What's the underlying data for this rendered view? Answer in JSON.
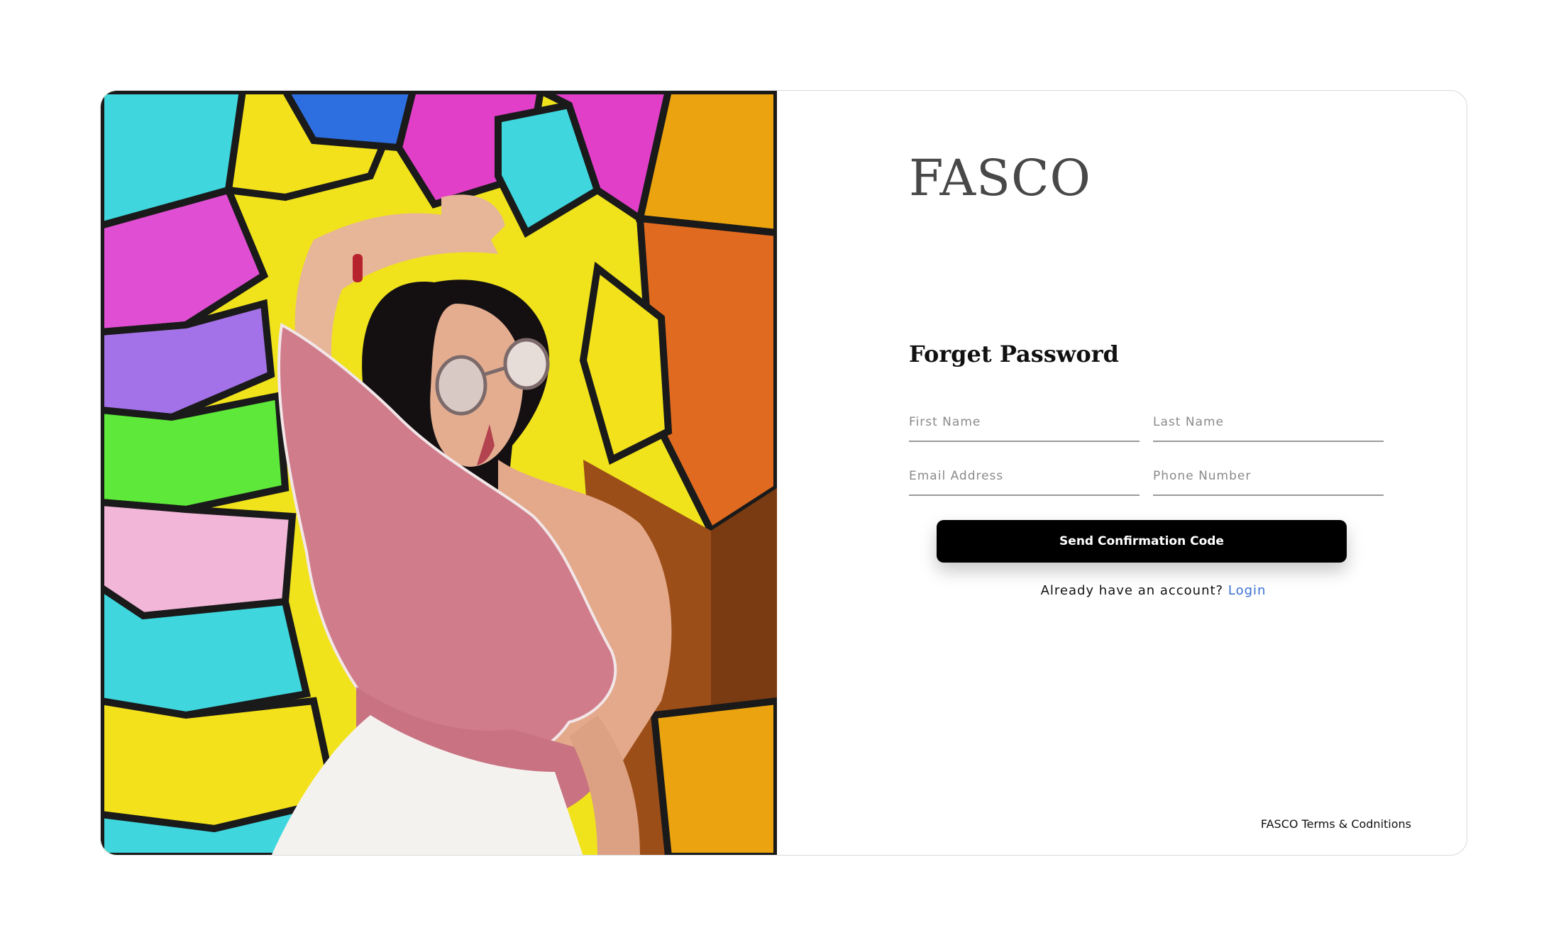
{
  "brand": {
    "name": "FASCO"
  },
  "hero": {
    "image": "woman-posing-graffiti-wall"
  },
  "form": {
    "heading": "Forget Password",
    "first_name_placeholder": "First Name",
    "last_name_placeholder": "Last Name",
    "email_placeholder": "Email Address",
    "phone_placeholder": "Phone Number",
    "submit_label": "Send Confirmation Code",
    "account_prompt": "Already have an account?",
    "login_link": "Login"
  },
  "footer": {
    "terms_link": "FASCO Terms & Codnitions"
  },
  "colors": {
    "button": "#000000",
    "link": "#3b6fd4",
    "brand_text": "#484848"
  }
}
